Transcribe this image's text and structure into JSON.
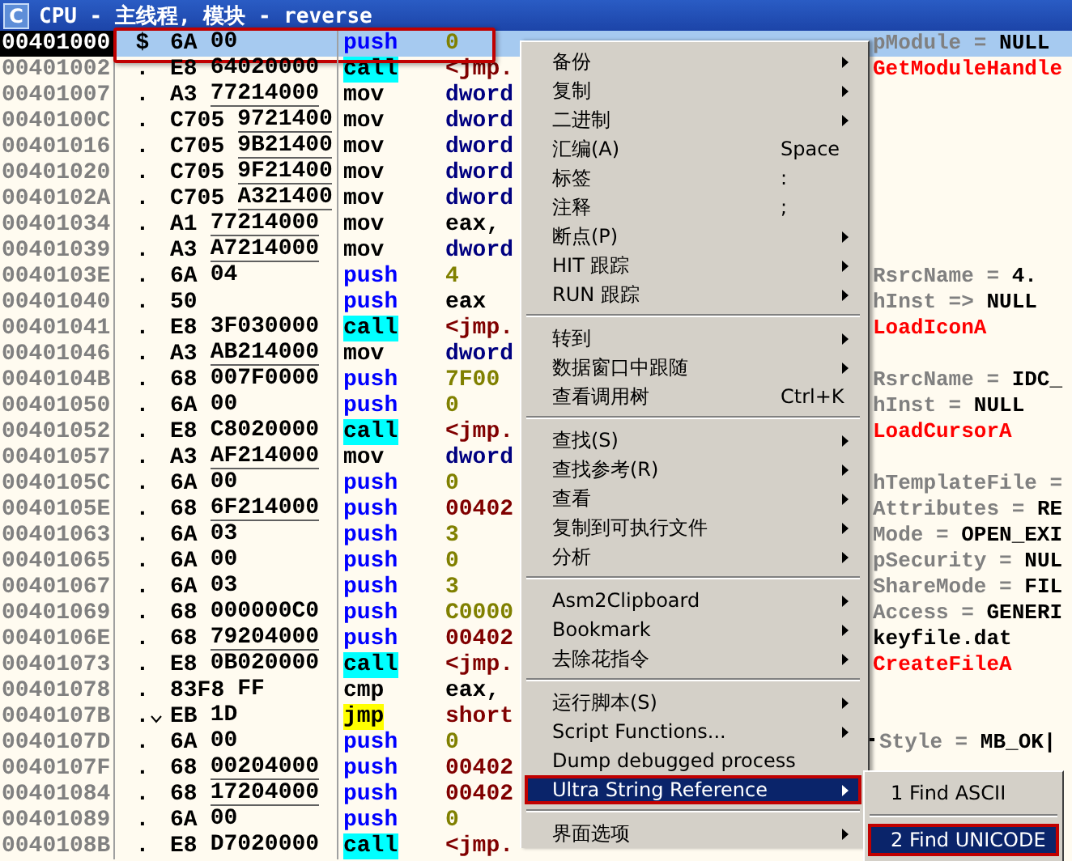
{
  "window": {
    "icon_letter": "C",
    "title": "CPU - 主线程, 模块 - reverse"
  },
  "rows": [
    {
      "address": "00401000",
      "marker": "$",
      "jump": false,
      "opcode": "6A",
      "ref": "00",
      "underline": false,
      "mnemonic": "push",
      "operand": {
        "text": "0",
        "kind": "const"
      },
      "selected": true,
      "annotated": true,
      "comment": {
        "kind": "arg",
        "label": "pModule =",
        "value": "NULL"
      }
    },
    {
      "address": "00401002",
      "marker": ".",
      "jump": false,
      "opcode": "E8",
      "ref": "64020000",
      "underline": false,
      "mnemonic": "call",
      "operand": {
        "text": "<jmp.",
        "kind": "addr"
      },
      "selected": false,
      "annotated": false,
      "comment": {
        "kind": "call",
        "value": "GetModuleHandle"
      }
    },
    {
      "address": "00401007",
      "marker": ".",
      "jump": false,
      "opcode": "A3",
      "ref": "77214000",
      "underline": true,
      "mnemonic": "mov",
      "operand": {
        "text": "dword",
        "kind": "mem"
      },
      "selected": false,
      "annotated": false
    },
    {
      "address": "0040100C",
      "marker": ".",
      "jump": false,
      "opcode": "C705",
      "ref": "9721400",
      "underline": true,
      "mnemonic": "mov",
      "operand": {
        "text": "dword",
        "kind": "mem"
      },
      "selected": false,
      "annotated": false
    },
    {
      "address": "00401016",
      "marker": ".",
      "jump": false,
      "opcode": "C705",
      "ref": "9B21400",
      "underline": true,
      "mnemonic": "mov",
      "operand": {
        "text": "dword",
        "kind": "mem"
      },
      "selected": false,
      "annotated": false
    },
    {
      "address": "00401020",
      "marker": ".",
      "jump": false,
      "opcode": "C705",
      "ref": "9F21400",
      "underline": true,
      "mnemonic": "mov",
      "operand": {
        "text": "dword",
        "kind": "mem"
      },
      "selected": false,
      "annotated": false
    },
    {
      "address": "0040102A",
      "marker": ".",
      "jump": false,
      "opcode": "C705",
      "ref": "A321400",
      "underline": true,
      "mnemonic": "mov",
      "operand": {
        "text": "dword",
        "kind": "mem"
      },
      "selected": false,
      "annotated": false
    },
    {
      "address": "00401034",
      "marker": ".",
      "jump": false,
      "opcode": "A1",
      "ref": "77214000",
      "underline": true,
      "mnemonic": "mov",
      "operand": {
        "text": "eax,",
        "kind": "reg"
      },
      "selected": false,
      "annotated": false
    },
    {
      "address": "00401039",
      "marker": ".",
      "jump": false,
      "opcode": "A3",
      "ref": "A7214000",
      "underline": true,
      "mnemonic": "mov",
      "operand": {
        "text": "dword",
        "kind": "mem"
      },
      "selected": false,
      "annotated": false
    },
    {
      "address": "0040103E",
      "marker": ".",
      "jump": false,
      "opcode": "6A",
      "ref": "04",
      "underline": false,
      "mnemonic": "push",
      "operand": {
        "text": "4",
        "kind": "const"
      },
      "selected": false,
      "annotated": false,
      "comment": {
        "kind": "arg",
        "label": "RsrcName =",
        "value": "4."
      }
    },
    {
      "address": "00401040",
      "marker": ".",
      "jump": false,
      "opcode": "50",
      "mnemonic": "push",
      "operand": {
        "text": "eax",
        "kind": "reg"
      },
      "selected": false,
      "annotated": false,
      "comment": {
        "kind": "arg",
        "label": "hInst =>",
        "value": "NULL"
      }
    },
    {
      "address": "00401041",
      "marker": ".",
      "jump": false,
      "opcode": "E8",
      "ref": "3F030000",
      "underline": false,
      "mnemonic": "call",
      "operand": {
        "text": "<jmp.",
        "kind": "addr"
      },
      "selected": false,
      "annotated": false,
      "comment": {
        "kind": "call",
        "value": "LoadIconA"
      }
    },
    {
      "address": "00401046",
      "marker": ".",
      "jump": false,
      "opcode": "A3",
      "ref": "AB214000",
      "underline": true,
      "mnemonic": "mov",
      "operand": {
        "text": "dword",
        "kind": "mem"
      },
      "selected": false,
      "annotated": false
    },
    {
      "address": "0040104B",
      "marker": ".",
      "jump": false,
      "opcode": "68",
      "ref": "007F0000",
      "underline": false,
      "mnemonic": "push",
      "operand": {
        "text": "7F00",
        "kind": "const"
      },
      "selected": false,
      "annotated": false,
      "comment": {
        "kind": "arg",
        "label": "RsrcName =",
        "value": "IDC_"
      }
    },
    {
      "address": "00401050",
      "marker": ".",
      "jump": false,
      "opcode": "6A",
      "ref": "00",
      "underline": false,
      "mnemonic": "push",
      "operand": {
        "text": "0",
        "kind": "const"
      },
      "selected": false,
      "annotated": false,
      "comment": {
        "kind": "arg",
        "label": "hInst =",
        "value": "NULL"
      }
    },
    {
      "address": "00401052",
      "marker": ".",
      "jump": false,
      "opcode": "E8",
      "ref": "C8020000",
      "underline": false,
      "mnemonic": "call",
      "operand": {
        "text": "<jmp.",
        "kind": "addr"
      },
      "selected": false,
      "annotated": false,
      "comment": {
        "kind": "call",
        "value": "LoadCursorA"
      }
    },
    {
      "address": "00401057",
      "marker": ".",
      "jump": false,
      "opcode": "A3",
      "ref": "AF214000",
      "underline": true,
      "mnemonic": "mov",
      "operand": {
        "text": "dword",
        "kind": "mem"
      },
      "selected": false,
      "annotated": false
    },
    {
      "address": "0040105C",
      "marker": ".",
      "jump": false,
      "opcode": "6A",
      "ref": "00",
      "underline": false,
      "mnemonic": "push",
      "operand": {
        "text": "0",
        "kind": "const"
      },
      "selected": false,
      "annotated": false,
      "comment": {
        "kind": "arg",
        "label": "hTemplateFile ="
      }
    },
    {
      "address": "0040105E",
      "marker": ".",
      "jump": false,
      "opcode": "68",
      "ref": "6F214000",
      "underline": true,
      "mnemonic": "push",
      "operand": {
        "text": "00402",
        "kind": "addr"
      },
      "selected": false,
      "annotated": false,
      "comment": {
        "kind": "arg",
        "label": "Attributes =",
        "value": "RE"
      }
    },
    {
      "address": "00401063",
      "marker": ".",
      "jump": false,
      "opcode": "6A",
      "ref": "03",
      "underline": false,
      "mnemonic": "push",
      "operand": {
        "text": "3",
        "kind": "const"
      },
      "selected": false,
      "annotated": false,
      "comment": {
        "kind": "arg",
        "label": "Mode =",
        "value": "OPEN_EXI"
      }
    },
    {
      "address": "00401065",
      "marker": ".",
      "jump": false,
      "opcode": "6A",
      "ref": "00",
      "underline": false,
      "mnemonic": "push",
      "operand": {
        "text": "0",
        "kind": "const"
      },
      "selected": false,
      "annotated": false,
      "comment": {
        "kind": "arg",
        "label": "pSecurity =",
        "value": "NUL"
      }
    },
    {
      "address": "00401067",
      "marker": ".",
      "jump": false,
      "opcode": "6A",
      "ref": "03",
      "underline": false,
      "mnemonic": "push",
      "operand": {
        "text": "3",
        "kind": "const"
      },
      "selected": false,
      "annotated": false,
      "comment": {
        "kind": "arg",
        "label": "ShareMode =",
        "value": "FIL"
      }
    },
    {
      "address": "00401069",
      "marker": ".",
      "jump": false,
      "opcode": "68",
      "ref": "000000C0",
      "underline": false,
      "mnemonic": "push",
      "operand": {
        "text": "C0000",
        "kind": "const"
      },
      "selected": false,
      "annotated": false,
      "comment": {
        "kind": "arg",
        "label": "Access =",
        "value": "GENERI"
      }
    },
    {
      "address": "0040106E",
      "marker": ".",
      "jump": false,
      "opcode": "68",
      "ref": "79204000",
      "underline": true,
      "mnemonic": "push",
      "operand": {
        "text": "00402",
        "kind": "addr"
      },
      "selected": false,
      "annotated": false,
      "comment": {
        "kind": "text",
        "value": "keyfile.dat"
      }
    },
    {
      "address": "00401073",
      "marker": ".",
      "jump": false,
      "opcode": "E8",
      "ref": "0B020000",
      "underline": false,
      "mnemonic": "call",
      "operand": {
        "text": "<jmp.",
        "kind": "addr"
      },
      "selected": false,
      "annotated": false,
      "comment": {
        "kind": "call",
        "value": "CreateFileA"
      }
    },
    {
      "address": "00401078",
      "marker": ".",
      "jump": false,
      "opcode": "83F8",
      "ref": "FF",
      "underline": false,
      "mnemonic": "cmp",
      "operand": {
        "text": "eax,",
        "kind": "reg"
      },
      "selected": false,
      "annotated": false
    },
    {
      "address": "0040107B",
      "marker": ".",
      "jump": true,
      "opcode": "EB",
      "ref": "1D",
      "underline": false,
      "mnemonic": "jmp",
      "operand": {
        "text": "short",
        "kind": "addr"
      },
      "selected": false,
      "annotated": false
    },
    {
      "address": "0040107D",
      "marker": ".",
      "jump": false,
      "opcode": "6A",
      "ref": "00",
      "underline": false,
      "mnemonic": "push",
      "operand": {
        "text": "0",
        "kind": "const"
      },
      "selected": false,
      "annotated": false,
      "comment": {
        "kind": "bracket",
        "label": "Style =",
        "value": "MB_OK|"
      }
    },
    {
      "address": "0040107F",
      "marker": ".",
      "jump": false,
      "opcode": "68",
      "ref": "00204000",
      "underline": true,
      "mnemonic": "push",
      "operand": {
        "text": "00402",
        "kind": "addr"
      },
      "selected": false,
      "annotated": false
    },
    {
      "address": "00401084",
      "marker": ".",
      "jump": false,
      "opcode": "68",
      "ref": "17204000",
      "underline": true,
      "mnemonic": "push",
      "operand": {
        "text": "00402",
        "kind": "addr"
      },
      "selected": false,
      "annotated": false
    },
    {
      "address": "00401089",
      "marker": ".",
      "jump": false,
      "opcode": "6A",
      "ref": "00",
      "underline": false,
      "mnemonic": "push",
      "operand": {
        "text": "0",
        "kind": "const"
      },
      "selected": false,
      "annotated": false
    },
    {
      "address": "0040108B",
      "marker": ".",
      "jump": false,
      "opcode": "E8",
      "ref": "D7020000",
      "underline": false,
      "mnemonic": "call",
      "operand": {
        "text": "<jmp.",
        "kind": "addr"
      },
      "selected": false,
      "annotated": false
    }
  ],
  "context_menu": [
    {
      "kind": "item",
      "label": "备份",
      "has_submenu": true,
      "selected": false
    },
    {
      "kind": "item",
      "label": "复制",
      "has_submenu": true,
      "selected": false
    },
    {
      "kind": "item",
      "label": "二进制",
      "has_submenu": true,
      "selected": false
    },
    {
      "kind": "item",
      "label": "汇编(A)",
      "shortcut": "Space",
      "has_submenu": false,
      "selected": false
    },
    {
      "kind": "item",
      "label": "标签",
      "shortcut": ":",
      "has_submenu": false,
      "selected": false
    },
    {
      "kind": "item",
      "label": "注释",
      "shortcut": ";",
      "has_submenu": false,
      "selected": false
    },
    {
      "kind": "item",
      "label": "断点(P)",
      "has_submenu": true,
      "selected": false
    },
    {
      "kind": "item",
      "label": "HIT 跟踪",
      "has_submenu": true,
      "selected": false
    },
    {
      "kind": "item",
      "label": "RUN 跟踪",
      "has_submenu": true,
      "selected": false
    },
    {
      "kind": "separator"
    },
    {
      "kind": "item",
      "label": "转到",
      "has_submenu": true,
      "selected": false
    },
    {
      "kind": "item",
      "label": "数据窗口中跟随",
      "has_submenu": true,
      "selected": false
    },
    {
      "kind": "item",
      "label": "查看调用树",
      "shortcut": "Ctrl+K",
      "has_submenu": false,
      "selected": false
    },
    {
      "kind": "separator"
    },
    {
      "kind": "item",
      "label": "查找(S)",
      "has_submenu": true,
      "selected": false
    },
    {
      "kind": "item",
      "label": "查找参考(R)",
      "has_submenu": true,
      "selected": false
    },
    {
      "kind": "item",
      "label": "查看",
      "has_submenu": true,
      "selected": false
    },
    {
      "kind": "item",
      "label": "复制到可执行文件",
      "has_submenu": true,
      "selected": false
    },
    {
      "kind": "item",
      "label": "分析",
      "has_submenu": true,
      "selected": false
    },
    {
      "kind": "separator"
    },
    {
      "kind": "item",
      "label": "Asm2Clipboard",
      "has_submenu": true,
      "selected": false
    },
    {
      "kind": "item",
      "label": "Bookmark",
      "has_submenu": true,
      "selected": false
    },
    {
      "kind": "item",
      "label": "去除花指令",
      "has_submenu": true,
      "selected": false
    },
    {
      "kind": "separator"
    },
    {
      "kind": "item",
      "label": "运行脚本(S)",
      "has_submenu": true,
      "selected": false
    },
    {
      "kind": "item",
      "label": "Script Functions...",
      "has_submenu": true,
      "selected": false
    },
    {
      "kind": "item",
      "label": "Dump debugged process",
      "has_submenu": false,
      "selected": false
    },
    {
      "kind": "item",
      "label": "Ultra String Reference",
      "has_submenu": true,
      "selected": true
    },
    {
      "kind": "separator"
    },
    {
      "kind": "item",
      "label": "界面选项",
      "has_submenu": true,
      "selected": false
    }
  ],
  "submenu": [
    {
      "kind": "item",
      "label": "1 Find ASCII",
      "selected": false
    },
    {
      "kind": "separator"
    },
    {
      "kind": "item",
      "label": "2 Find UNICODE",
      "selected": true
    }
  ]
}
